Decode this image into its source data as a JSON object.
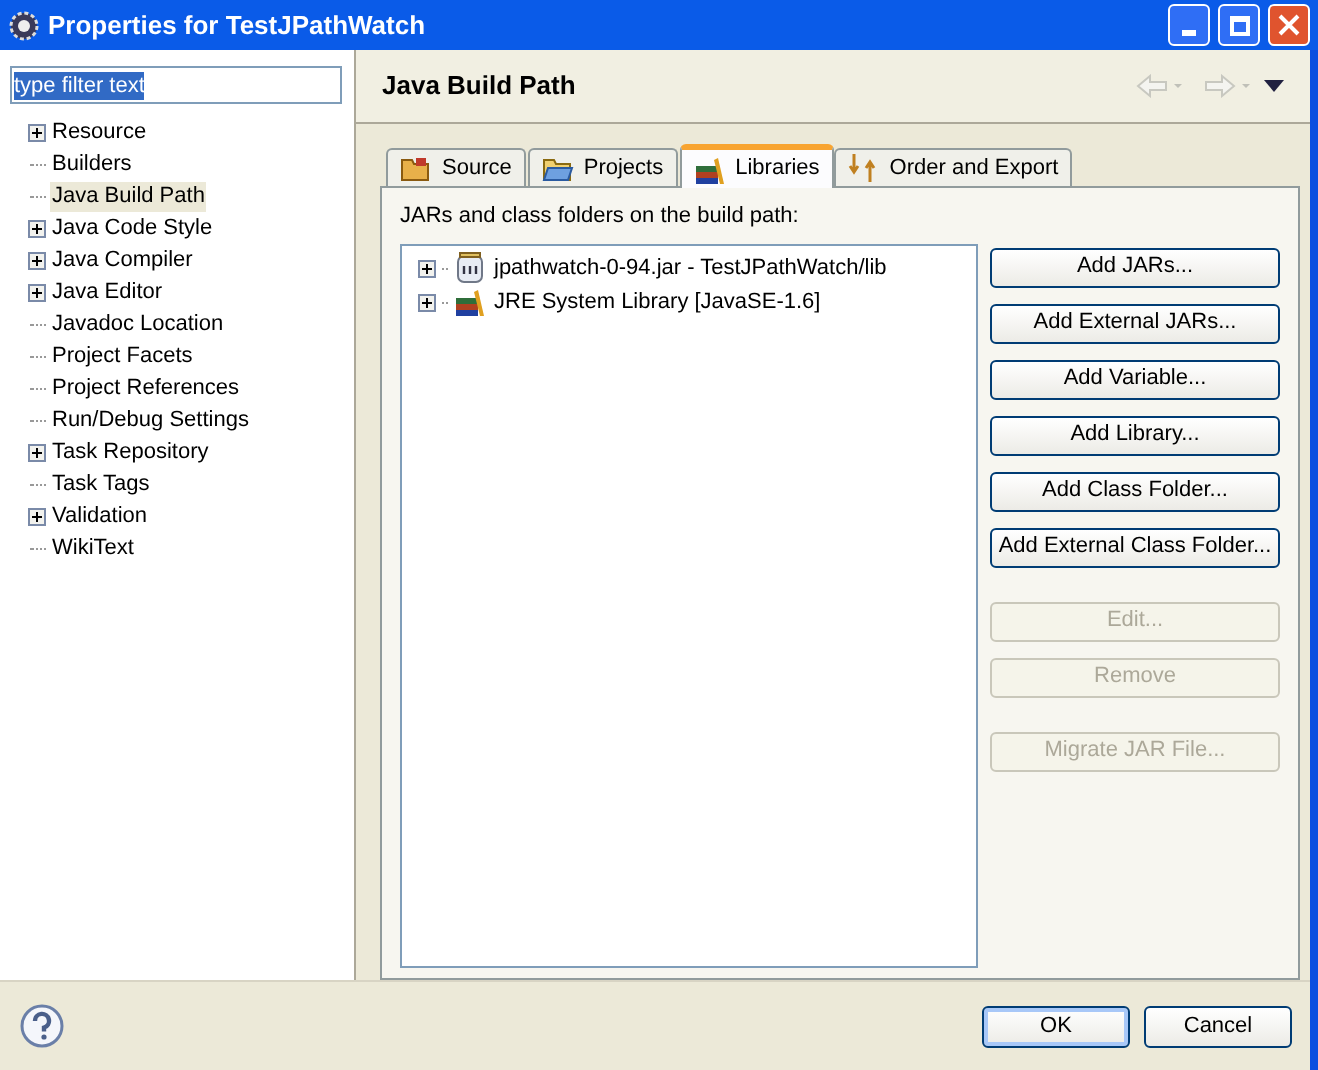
{
  "window": {
    "title": "Properties for TestJPathWatch"
  },
  "filter": {
    "value": "type filter text",
    "selected": true
  },
  "nav": {
    "items": [
      {
        "label": "Resource",
        "expandable": true,
        "selected": false
      },
      {
        "label": "Builders",
        "expandable": false,
        "selected": false
      },
      {
        "label": "Java Build Path",
        "expandable": false,
        "selected": true
      },
      {
        "label": "Java Code Style",
        "expandable": true,
        "selected": false
      },
      {
        "label": "Java Compiler",
        "expandable": true,
        "selected": false
      },
      {
        "label": "Java Editor",
        "expandable": true,
        "selected": false
      },
      {
        "label": "Javadoc Location",
        "expandable": false,
        "selected": false
      },
      {
        "label": "Project Facets",
        "expandable": false,
        "selected": false
      },
      {
        "label": "Project References",
        "expandable": false,
        "selected": false
      },
      {
        "label": "Run/Debug Settings",
        "expandable": false,
        "selected": false
      },
      {
        "label": "Task Repository",
        "expandable": true,
        "selected": false
      },
      {
        "label": "Task Tags",
        "expandable": false,
        "selected": false
      },
      {
        "label": "Validation",
        "expandable": true,
        "selected": false
      },
      {
        "label": "WikiText",
        "expandable": false,
        "selected": false
      }
    ]
  },
  "page": {
    "title": "Java Build Path"
  },
  "tabs": [
    {
      "label": "Source",
      "kind": "source",
      "selected": false
    },
    {
      "label": "Projects",
      "kind": "projects",
      "selected": false
    },
    {
      "label": "Libraries",
      "kind": "libraries",
      "selected": true
    },
    {
      "label": "Order and Export",
      "kind": "order",
      "selected": false
    }
  ],
  "libraries_label": "JARs and class folders on the build path:",
  "libraries": [
    {
      "label": "jpathwatch-0-94.jar - TestJPathWatch/lib",
      "kind": "jar",
      "expandable": true
    },
    {
      "label": "JRE System Library [JavaSE-1.6]",
      "kind": "library",
      "expandable": true
    }
  ],
  "button_groups": [
    {
      "buttons": [
        {
          "label": "Add JARs...",
          "disabled": false
        },
        {
          "label": "Add External JARs...",
          "disabled": false
        },
        {
          "label": "Add Variable...",
          "disabled": false
        },
        {
          "label": "Add Library...",
          "disabled": false
        },
        {
          "label": "Add Class Folder...",
          "disabled": false
        },
        {
          "label": "Add External Class Folder...",
          "disabled": false
        }
      ]
    },
    {
      "buttons": [
        {
          "label": "Edit...",
          "disabled": true
        },
        {
          "label": "Remove",
          "disabled": true
        }
      ]
    },
    {
      "buttons": [
        {
          "label": "Migrate JAR File...",
          "disabled": true
        }
      ]
    }
  ],
  "footer_buttons": [
    {
      "label": "OK",
      "default": true
    },
    {
      "label": "Cancel",
      "default": false
    }
  ]
}
